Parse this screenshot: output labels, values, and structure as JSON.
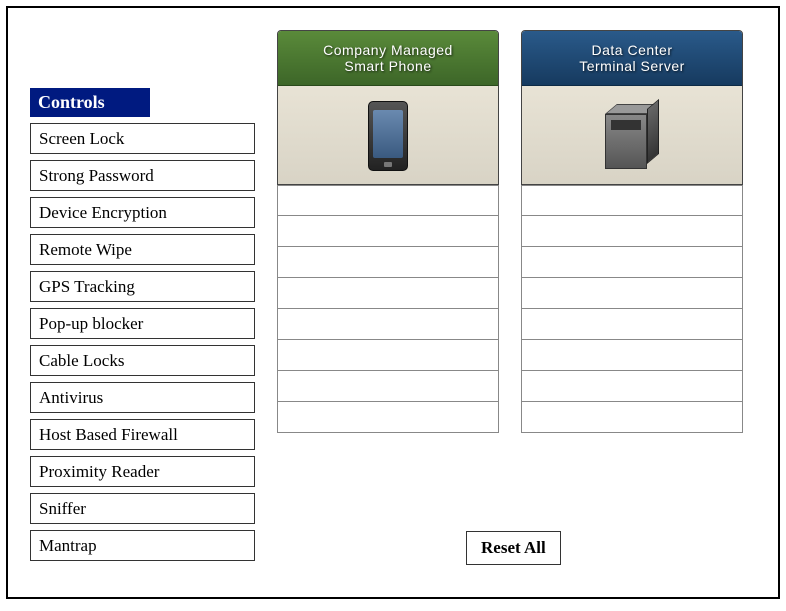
{
  "controls": {
    "header": "Controls",
    "items": [
      "Screen Lock",
      "Strong Password",
      "Device Encryption",
      "Remote Wipe",
      "GPS Tracking",
      "Pop-up blocker",
      "Cable Locks",
      "Antivirus",
      "Host Based Firewall",
      "Proximity Reader",
      "Sniffer",
      "Mantrap"
    ]
  },
  "dropzones": [
    {
      "title_line1": "Company Managed",
      "title_line2": "Smart Phone",
      "color": "green",
      "icon": "phone",
      "slot_count": 8
    },
    {
      "title_line1": "Data Center",
      "title_line2": "Terminal Server",
      "color": "blue",
      "icon": "server",
      "slot_count": 8
    }
  ],
  "reset_label": "Reset All"
}
